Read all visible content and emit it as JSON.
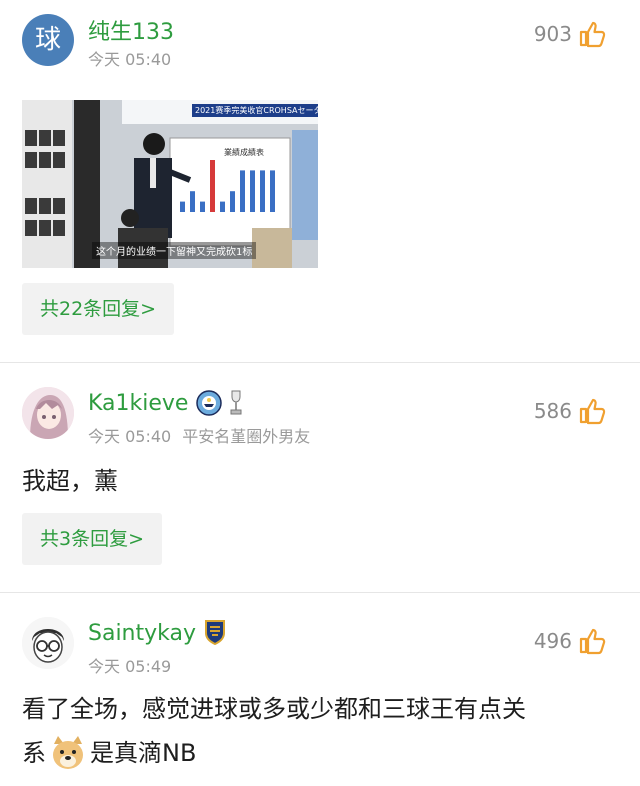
{
  "comments": [
    {
      "avatar_text": "球",
      "username": "纯生133",
      "time": "今天 05:40",
      "likes": "903",
      "image": {
        "banner": "2021赛季完美收官CROHSAセーター",
        "board_title": "業績成績表",
        "caption": "这个月的业绩一下留神又完成砍1标",
        "bar_values": [
          1,
          2,
          1,
          5,
          1,
          2,
          4,
          4,
          4,
          4
        ]
      },
      "replies": "共22条回复>"
    },
    {
      "username": "Ka1kieve",
      "time": "今天 05:40",
      "tag": "平安名堇圈外男友",
      "likes": "586",
      "text": "我超，薰",
      "replies": "共3条回复>"
    },
    {
      "username": "Saintykay",
      "time": "今天 05:49",
      "likes": "496",
      "text_line1": "看了全场，感觉进球或多或少都和三球王有点关",
      "text_line2_pre": "系",
      "text_line2_post": "是真滴NB"
    }
  ],
  "colors": {
    "username": "#2e9c3f",
    "like_icon": "#f0a030",
    "avatar1": "#4a7fb8"
  }
}
